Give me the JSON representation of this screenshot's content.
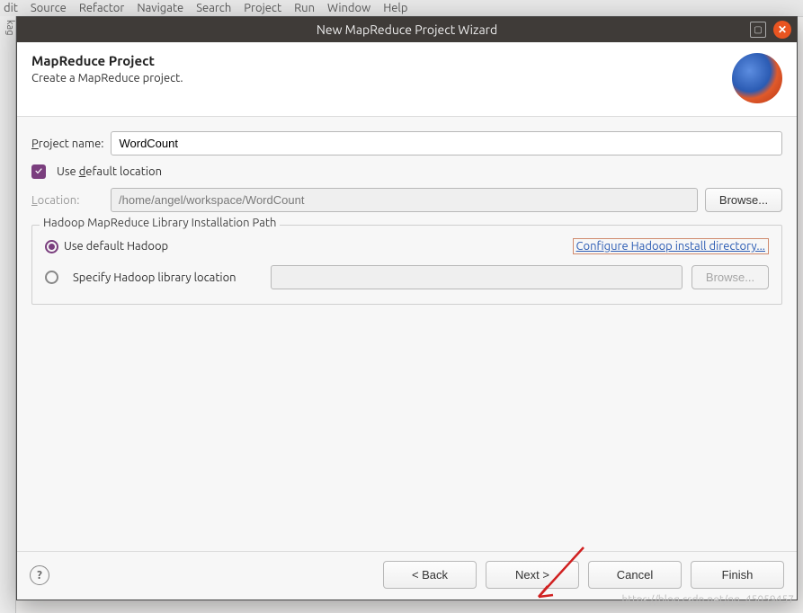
{
  "menubar": [
    "dit",
    "Source",
    "Refactor",
    "Navigate",
    "Search",
    "Project",
    "Run",
    "Window",
    "Help"
  ],
  "sideband": "kag",
  "dialog": {
    "title": "New MapReduce Project Wizard",
    "heading": "MapReduce Project",
    "subheading": "Create a MapReduce project."
  },
  "form": {
    "project_name_label": "Project name:",
    "project_name_value": "WordCount",
    "use_default_location_label": "Use default location",
    "use_default_location_checked": true,
    "location_label": "Location:",
    "location_value": "/home/angel/workspace/WordCount",
    "browse_label": "Browse..."
  },
  "libgroup": {
    "legend": "Hadoop MapReduce Library Installation Path",
    "use_default_label": "Use default Hadoop",
    "configure_link": "Configure Hadoop install directory...",
    "specify_label": "Specify Hadoop library location",
    "specify_value": "",
    "browse_label": "Browse..."
  },
  "footer": {
    "back": "< Back",
    "next": "Next >",
    "cancel": "Cancel",
    "finish": "Finish"
  },
  "watermark": "https://blog.csdn.net/qq_45059457"
}
